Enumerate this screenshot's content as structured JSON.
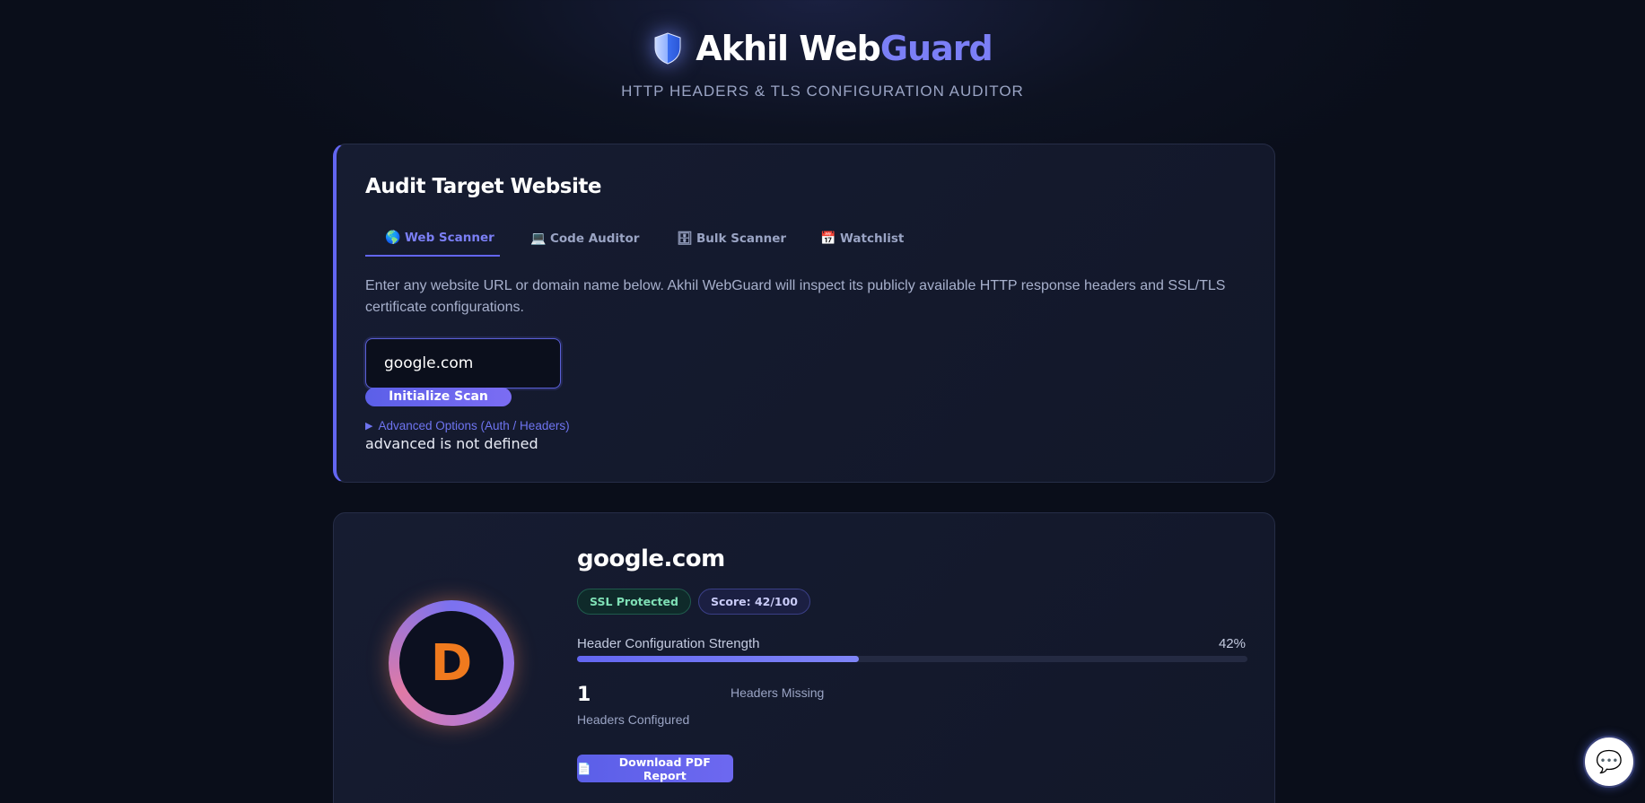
{
  "brand": {
    "name_part1": "Akhil Web",
    "name_part2": "Guard",
    "subtitle": "HTTP HEADERS & TLS CONFIGURATION AUDITOR",
    "logo_icon": "shield-icon"
  },
  "audit": {
    "title": "Audit Target Website",
    "tabs": [
      {
        "icon": "🌎",
        "label": "Web Scanner",
        "active": true
      },
      {
        "icon": "💻",
        "label": "Code Auditor",
        "active": false
      },
      {
        "icon": "🗄",
        "label": "Bulk Scanner",
        "active": false
      },
      {
        "icon": "📅",
        "label": "Watchlist",
        "active": false
      }
    ],
    "description": "Enter any website URL or domain name below. Akhil WebGuard will inspect its publicly available HTTP response headers and SSL/TLS certificate configurations.",
    "input_value": "google.com",
    "scan_button": "Initialize Scan",
    "advanced_toggle": "Advanced Options (Auth / Headers)",
    "error_message": "advanced is not defined"
  },
  "result": {
    "grade": "D",
    "domain": "google.com",
    "badges": {
      "ssl": "SSL Protected",
      "score": "Score: 42/100"
    },
    "strength_label": "Header Configuration Strength",
    "strength_pct_text": "42%",
    "strength_fraction": 0.42,
    "headers_configured_count": "1",
    "headers_configured_label": "Headers Configured",
    "headers_missing_label": "Headers Missing",
    "pdf_button": "Download PDF Report",
    "pdf_icon": "document-icon"
  },
  "chat": {
    "icon": "chat-bubble-icon",
    "glyph": "💬"
  },
  "colors": {
    "accent": "#6366f1",
    "grade_color": "#f07a1e",
    "ssl_green": "#7fe0b6"
  }
}
